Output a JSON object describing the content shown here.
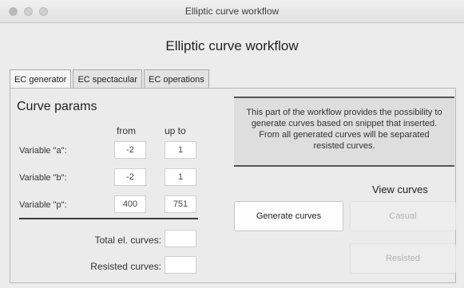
{
  "window": {
    "title": "Elliptic curve workflow"
  },
  "app": {
    "heading": "Elliptic curve workflow"
  },
  "tabs": [
    {
      "label": "EC generator",
      "active": true
    },
    {
      "label": "EC spectacular",
      "active": false
    },
    {
      "label": "EC operations",
      "active": false
    }
  ],
  "curve_params": {
    "heading": "Curve params",
    "col_from": "from",
    "col_up_to": "up to",
    "rows": [
      {
        "label": "Variable \"a\":",
        "from": "-2",
        "up_to": "1"
      },
      {
        "label": "Variable \"b\":",
        "from": "-2",
        "up_to": "1"
      },
      {
        "label": "Variable \"p\":",
        "from": "400",
        "up_to": "751"
      }
    ]
  },
  "results": {
    "total_label": "Total el. curves:",
    "total_value": "",
    "resisted_label": "Resisted curves:",
    "resisted_value": ""
  },
  "info": {
    "text": "This part of the workflow provides the possibility to generate curves based on snippet that inserted. From all generated curves will be separated resisted curves."
  },
  "actions": {
    "view_heading": "View curves",
    "generate_label": "Generate curves",
    "casual_label": "Casual",
    "resisted_label": "Resisted"
  }
}
